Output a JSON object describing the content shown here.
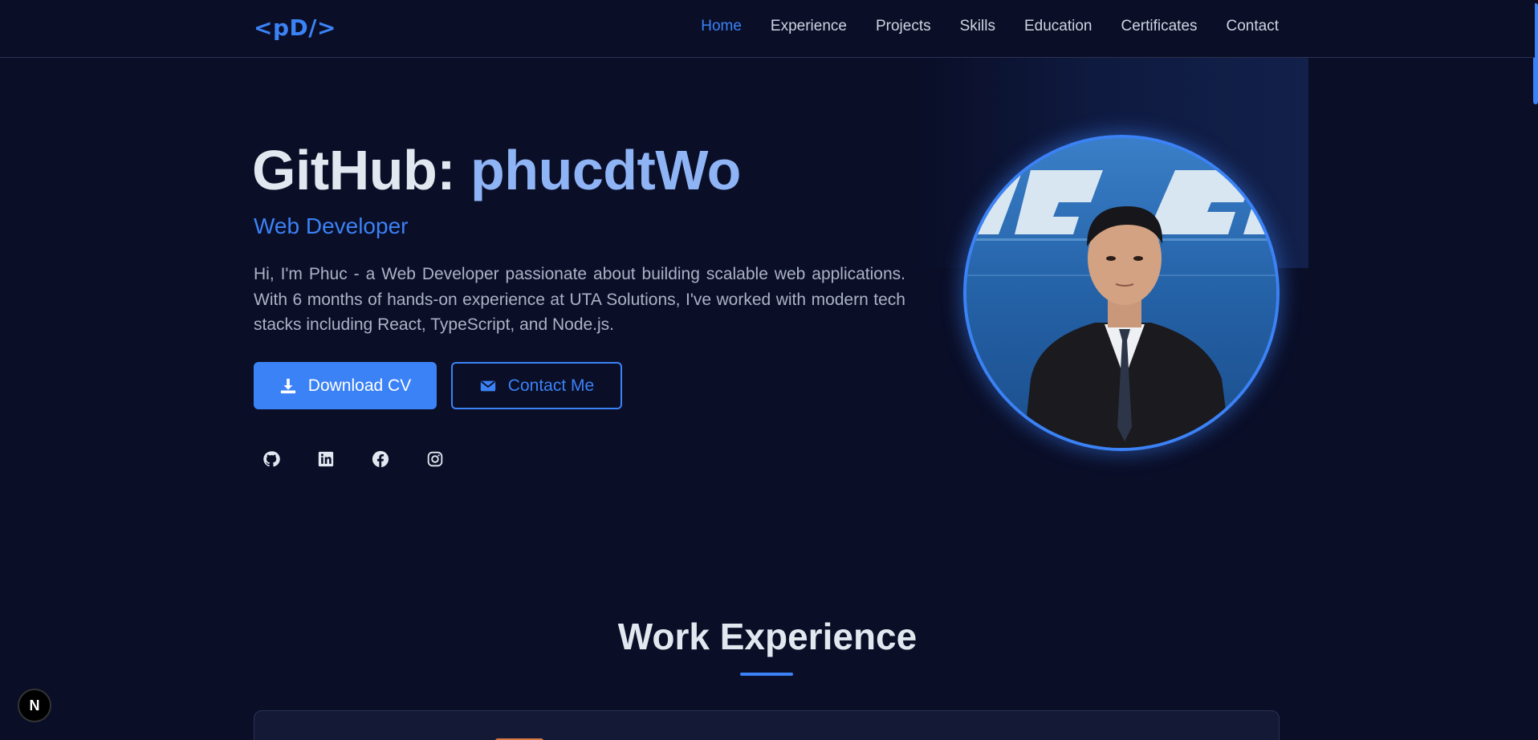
{
  "nav": {
    "logo": "<pD/>",
    "links": [
      {
        "label": "Home",
        "active": true
      },
      {
        "label": "Experience",
        "active": false
      },
      {
        "label": "Projects",
        "active": false
      },
      {
        "label": "Skills",
        "active": false
      },
      {
        "label": "Education",
        "active": false
      },
      {
        "label": "Certificates",
        "active": false
      },
      {
        "label": "Contact",
        "active": false
      }
    ]
  },
  "hero": {
    "title_prefix": "GitHub: ",
    "title_accent": "phucdtWo",
    "subtitle": "Web Developer",
    "description": "Hi, I'm Phuc - a Web Developer passionate about building scalable web applications. With 6 months of hands-on experience at UTA Solutions, I've worked with modern tech stacks including React, TypeScript, and Node.js.",
    "buttons": {
      "download_cv": "Download CV",
      "contact_me": "Contact Me"
    },
    "socials": [
      "github-icon",
      "linkedin-icon",
      "facebook-icon",
      "instagram-icon"
    ]
  },
  "section": {
    "title": "Work Experience"
  },
  "dev_badge": "N",
  "colors": {
    "background": "#0a0e27",
    "accent": "#3b82f6",
    "title_accent": "#8fb4f5",
    "text_muted": "#aab3c5"
  }
}
